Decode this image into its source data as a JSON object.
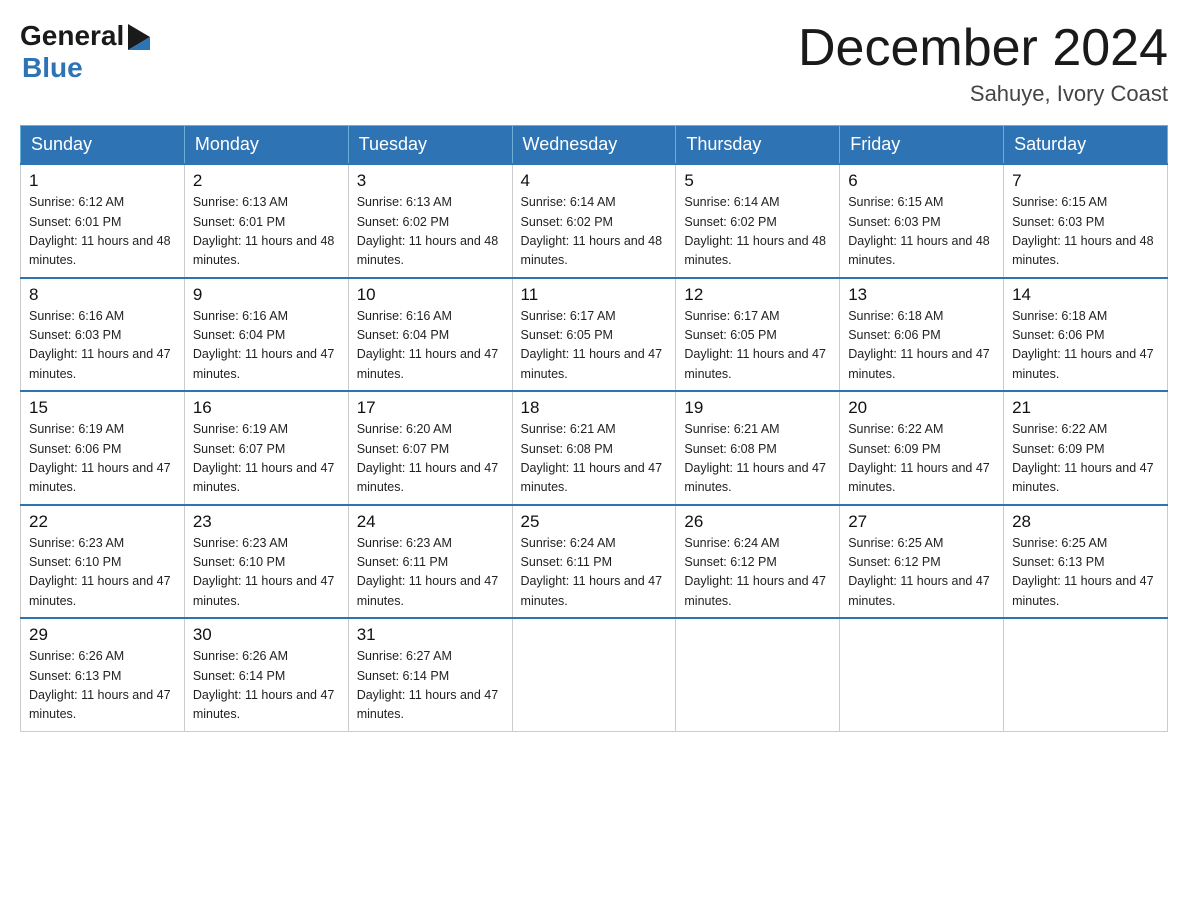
{
  "logo": {
    "text_general": "General",
    "triangle_symbol": "▶",
    "text_blue": "Blue"
  },
  "header": {
    "title": "December 2024",
    "subtitle": "Sahuye, Ivory Coast"
  },
  "weekdays": [
    "Sunday",
    "Monday",
    "Tuesday",
    "Wednesday",
    "Thursday",
    "Friday",
    "Saturday"
  ],
  "weeks": [
    [
      {
        "day": "1",
        "sunrise": "6:12 AM",
        "sunset": "6:01 PM",
        "daylight": "11 hours and 48 minutes."
      },
      {
        "day": "2",
        "sunrise": "6:13 AM",
        "sunset": "6:01 PM",
        "daylight": "11 hours and 48 minutes."
      },
      {
        "day": "3",
        "sunrise": "6:13 AM",
        "sunset": "6:02 PM",
        "daylight": "11 hours and 48 minutes."
      },
      {
        "day": "4",
        "sunrise": "6:14 AM",
        "sunset": "6:02 PM",
        "daylight": "11 hours and 48 minutes."
      },
      {
        "day": "5",
        "sunrise": "6:14 AM",
        "sunset": "6:02 PM",
        "daylight": "11 hours and 48 minutes."
      },
      {
        "day": "6",
        "sunrise": "6:15 AM",
        "sunset": "6:03 PM",
        "daylight": "11 hours and 48 minutes."
      },
      {
        "day": "7",
        "sunrise": "6:15 AM",
        "sunset": "6:03 PM",
        "daylight": "11 hours and 48 minutes."
      }
    ],
    [
      {
        "day": "8",
        "sunrise": "6:16 AM",
        "sunset": "6:03 PM",
        "daylight": "11 hours and 47 minutes."
      },
      {
        "day": "9",
        "sunrise": "6:16 AM",
        "sunset": "6:04 PM",
        "daylight": "11 hours and 47 minutes."
      },
      {
        "day": "10",
        "sunrise": "6:16 AM",
        "sunset": "6:04 PM",
        "daylight": "11 hours and 47 minutes."
      },
      {
        "day": "11",
        "sunrise": "6:17 AM",
        "sunset": "6:05 PM",
        "daylight": "11 hours and 47 minutes."
      },
      {
        "day": "12",
        "sunrise": "6:17 AM",
        "sunset": "6:05 PM",
        "daylight": "11 hours and 47 minutes."
      },
      {
        "day": "13",
        "sunrise": "6:18 AM",
        "sunset": "6:06 PM",
        "daylight": "11 hours and 47 minutes."
      },
      {
        "day": "14",
        "sunrise": "6:18 AM",
        "sunset": "6:06 PM",
        "daylight": "11 hours and 47 minutes."
      }
    ],
    [
      {
        "day": "15",
        "sunrise": "6:19 AM",
        "sunset": "6:06 PM",
        "daylight": "11 hours and 47 minutes."
      },
      {
        "day": "16",
        "sunrise": "6:19 AM",
        "sunset": "6:07 PM",
        "daylight": "11 hours and 47 minutes."
      },
      {
        "day": "17",
        "sunrise": "6:20 AM",
        "sunset": "6:07 PM",
        "daylight": "11 hours and 47 minutes."
      },
      {
        "day": "18",
        "sunrise": "6:21 AM",
        "sunset": "6:08 PM",
        "daylight": "11 hours and 47 minutes."
      },
      {
        "day": "19",
        "sunrise": "6:21 AM",
        "sunset": "6:08 PM",
        "daylight": "11 hours and 47 minutes."
      },
      {
        "day": "20",
        "sunrise": "6:22 AM",
        "sunset": "6:09 PM",
        "daylight": "11 hours and 47 minutes."
      },
      {
        "day": "21",
        "sunrise": "6:22 AM",
        "sunset": "6:09 PM",
        "daylight": "11 hours and 47 minutes."
      }
    ],
    [
      {
        "day": "22",
        "sunrise": "6:23 AM",
        "sunset": "6:10 PM",
        "daylight": "11 hours and 47 minutes."
      },
      {
        "day": "23",
        "sunrise": "6:23 AM",
        "sunset": "6:10 PM",
        "daylight": "11 hours and 47 minutes."
      },
      {
        "day": "24",
        "sunrise": "6:23 AM",
        "sunset": "6:11 PM",
        "daylight": "11 hours and 47 minutes."
      },
      {
        "day": "25",
        "sunrise": "6:24 AM",
        "sunset": "6:11 PM",
        "daylight": "11 hours and 47 minutes."
      },
      {
        "day": "26",
        "sunrise": "6:24 AM",
        "sunset": "6:12 PM",
        "daylight": "11 hours and 47 minutes."
      },
      {
        "day": "27",
        "sunrise": "6:25 AM",
        "sunset": "6:12 PM",
        "daylight": "11 hours and 47 minutes."
      },
      {
        "day": "28",
        "sunrise": "6:25 AM",
        "sunset": "6:13 PM",
        "daylight": "11 hours and 47 minutes."
      }
    ],
    [
      {
        "day": "29",
        "sunrise": "6:26 AM",
        "sunset": "6:13 PM",
        "daylight": "11 hours and 47 minutes."
      },
      {
        "day": "30",
        "sunrise": "6:26 AM",
        "sunset": "6:14 PM",
        "daylight": "11 hours and 47 minutes."
      },
      {
        "day": "31",
        "sunrise": "6:27 AM",
        "sunset": "6:14 PM",
        "daylight": "11 hours and 47 minutes."
      },
      null,
      null,
      null,
      null
    ]
  ],
  "labels": {
    "sunrise": "Sunrise:",
    "sunset": "Sunset:",
    "daylight": "Daylight:"
  }
}
